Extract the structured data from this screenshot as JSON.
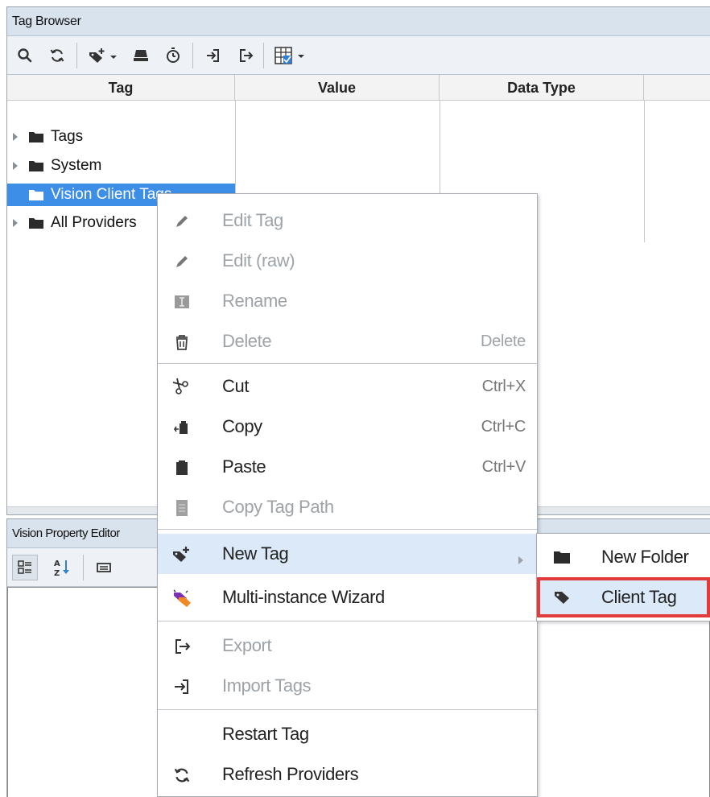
{
  "tag_browser": {
    "title": "Tag Browser",
    "toolbar_icons": [
      "search-icon",
      "refresh-icon",
      "add-tag-dropdown-icon",
      "tag-provider-icon",
      "history-icon",
      "import-icon",
      "export-icon",
      "column-chooser-icon"
    ],
    "columns": [
      "Tag",
      "Value",
      "Data Type"
    ],
    "tree": [
      {
        "label": "Tags",
        "expandable": true,
        "selected": false
      },
      {
        "label": "System",
        "expandable": true,
        "selected": false
      },
      {
        "label": "Vision Client Tags",
        "expandable": false,
        "selected": true
      },
      {
        "label": "All Providers",
        "expandable": true,
        "selected": false
      }
    ]
  },
  "property_editor": {
    "title": "Vision Property Editor",
    "toolbar_icons": [
      "categorized-view-icon",
      "sort-alphabetical-icon",
      "property-display-icon"
    ]
  },
  "context_menu": {
    "items": [
      {
        "label": "Edit Tag",
        "shortcut": "",
        "icon": "pencil-icon",
        "enabled": false
      },
      {
        "label": "Edit (raw)",
        "shortcut": "",
        "icon": "pencil-icon",
        "enabled": false
      },
      {
        "label": "Rename",
        "shortcut": "",
        "icon": "rename-icon",
        "enabled": false
      },
      {
        "label": "Delete",
        "shortcut": "Delete",
        "icon": "trash-icon",
        "enabled": false
      },
      {
        "label": "Cut",
        "shortcut": "Ctrl+X",
        "icon": "scissors-icon",
        "enabled": true
      },
      {
        "label": "Copy",
        "shortcut": "Ctrl+C",
        "icon": "copy-icon",
        "enabled": true
      },
      {
        "label": "Paste",
        "shortcut": "Ctrl+V",
        "icon": "clipboard-icon",
        "enabled": true
      },
      {
        "label": "Copy Tag Path",
        "shortcut": "",
        "icon": "copy-path-icon",
        "enabled": false
      },
      {
        "label": "New Tag",
        "shortcut": "",
        "icon": "new-tag-icon",
        "enabled": true,
        "submenu": true,
        "hover": true
      },
      {
        "label": "Multi-instance Wizard",
        "shortcut": "",
        "icon": "wizard-icon",
        "enabled": true
      },
      {
        "label": "Export",
        "shortcut": "",
        "icon": "export-icon",
        "enabled": false
      },
      {
        "label": "Import Tags",
        "shortcut": "",
        "icon": "import-icon",
        "enabled": false
      },
      {
        "label": "Restart Tag",
        "shortcut": "",
        "icon": "",
        "enabled": true
      },
      {
        "label": "Refresh Providers",
        "shortcut": "",
        "icon": "refresh-icon",
        "enabled": true
      }
    ]
  },
  "submenu": {
    "items": [
      {
        "label": "New Folder",
        "icon": "folder-icon"
      },
      {
        "label": "Client Tag",
        "icon": "tag-icon",
        "highlighted": true
      }
    ]
  },
  "colors": {
    "selection": "#3d8ee6",
    "hover": "#dbe9f9",
    "highlight_border": "#e23b3b",
    "panel_title_bg": "#d9e3ed"
  }
}
